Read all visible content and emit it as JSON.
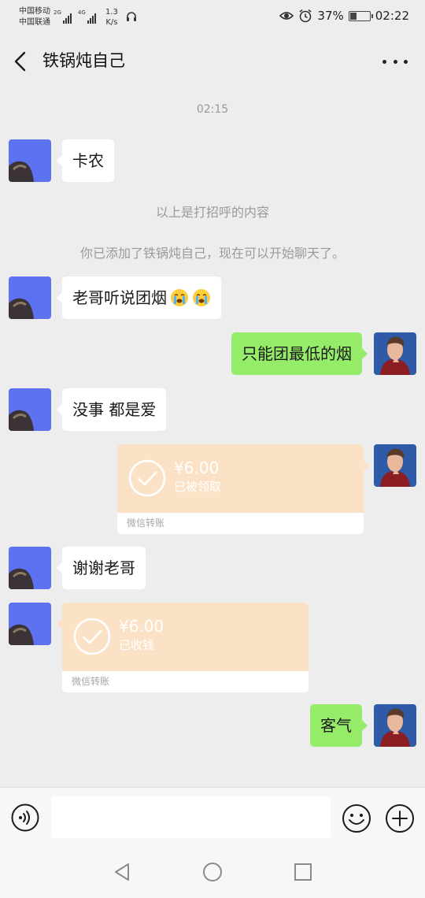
{
  "status_bar": {
    "carrier_1": "中国移动",
    "carrier_2": "中国联通",
    "signal_1_tag": "2G",
    "signal_2_tag": "4G",
    "net_speed_value": "1.3",
    "net_speed_unit": "K/s",
    "battery": "37%",
    "battery_level": 0.37,
    "time": "02:22"
  },
  "header": {
    "title": "铁锅炖自己"
  },
  "chat": {
    "timestamp": "02:15",
    "messages": [
      {
        "side": "left",
        "text": "卡农"
      },
      {
        "system": "以上是打招呼的内容"
      },
      {
        "system": "你已添加了铁锅炖自己，现在可以开始聊天了。"
      },
      {
        "side": "left",
        "text": "老哥听说团烟",
        "emoji": "crying-face-icon"
      },
      {
        "side": "right",
        "text": "只能团最低的烟"
      },
      {
        "side": "left",
        "text": "没事 都是爱"
      },
      {
        "side": "right",
        "type": "transfer",
        "amount": "¥6.00",
        "status": "已被领取",
        "label": "微信转账"
      },
      {
        "side": "left",
        "text": "谢谢老哥"
      },
      {
        "side": "left",
        "type": "transfer",
        "amount": "¥6.00",
        "status": "已收钱",
        "label": "微信转账"
      },
      {
        "side": "right",
        "text": "客气"
      }
    ]
  },
  "input": {
    "value": "",
    "placeholder": ""
  },
  "colors": {
    "background": "#ededed",
    "bubble_right": "#95ec69",
    "bubble_left": "#ffffff",
    "transfer": "#fbe2c6",
    "system_text": "#9a9a9a"
  },
  "icons": [
    "back-arrow-icon",
    "more-dots-icon",
    "voice-icon",
    "emoji-icon",
    "plus-icon",
    "nav-back-icon",
    "nav-home-icon",
    "nav-recent-icon",
    "check-circle-icon"
  ]
}
